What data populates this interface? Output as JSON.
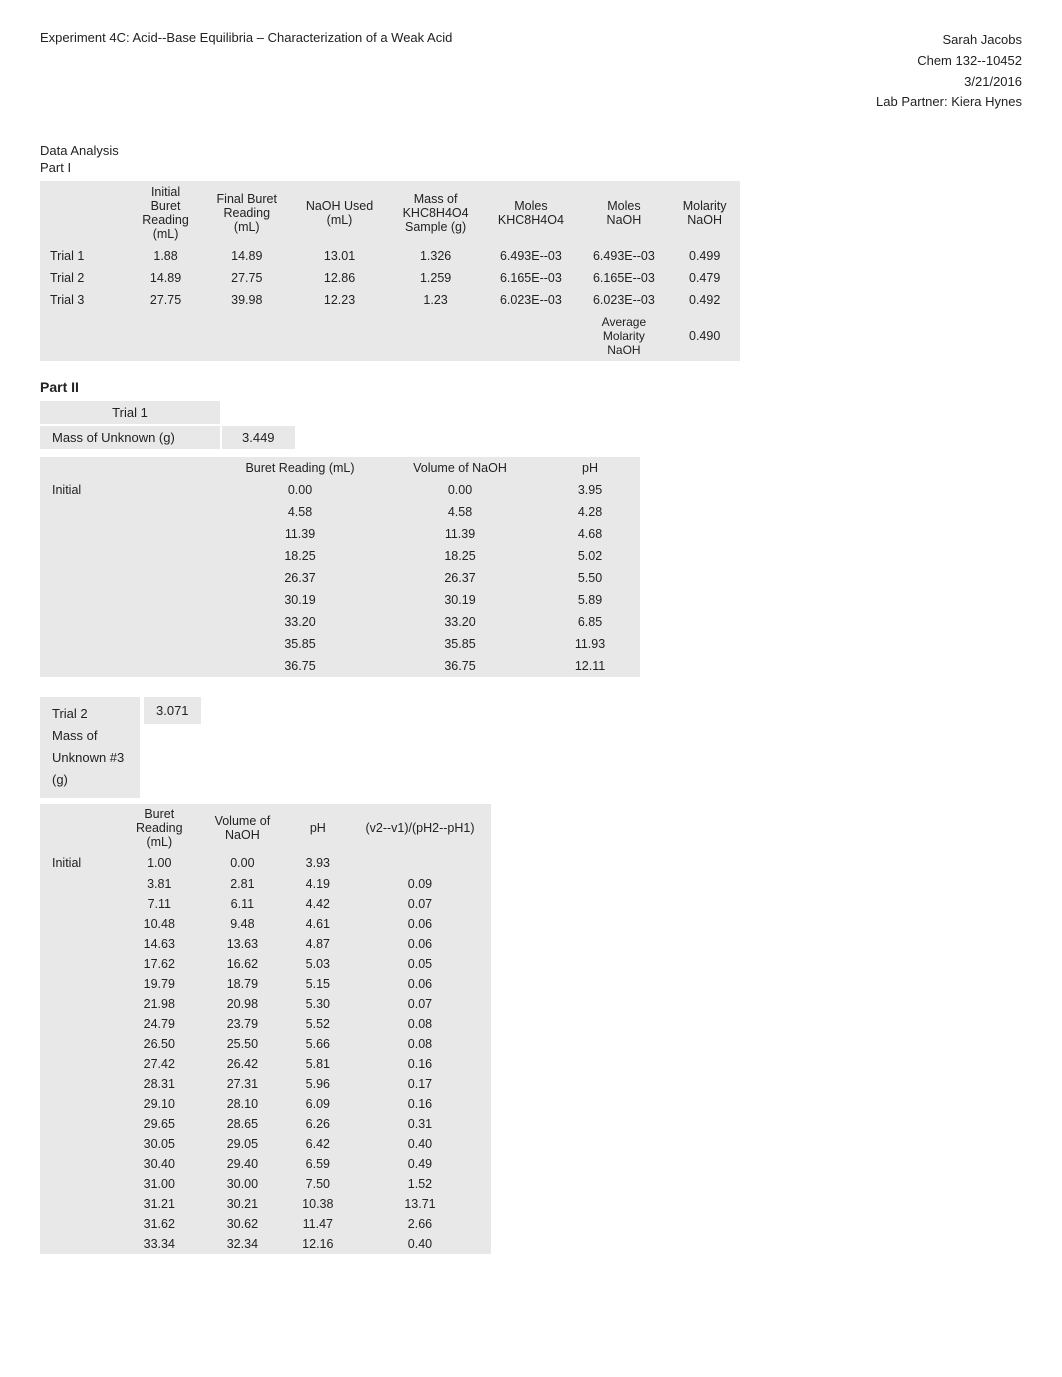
{
  "header": {
    "title": "Experiment 4C: Acid--Base Equilibria – Characterization of a Weak Acid",
    "name": "Sarah Jacobs",
    "course": "Chem 132--10452",
    "date": "3/21/2016",
    "partner": "Lab Partner: Kiera Hynes"
  },
  "dataAnalysis": "Data Analysis",
  "partI": {
    "label": "Part I",
    "columns": [
      "",
      "Initial Buret Reading (mL)",
      "Final Buret Reading (mL)",
      "NaOH Used (mL)",
      "Mass of KHC8H4O4 Sample (g)",
      "Moles KHC8H4O4",
      "Moles NaOH",
      "Molarity NaOH"
    ],
    "rows": [
      {
        "label": "Trial 1",
        "initial": "1.88",
        "final": "14.89",
        "used": "13.01",
        "mass": "1.326",
        "moles_khc": "6.493E--03",
        "moles_naoh": "6.493E--03",
        "molarity": "0.499"
      },
      {
        "label": "Trial 2",
        "initial": "14.89",
        "final": "27.75",
        "used": "12.86",
        "mass": "1.259",
        "moles_khc": "6.165E--03",
        "moles_naoh": "6.165E--03",
        "molarity": "0.479"
      },
      {
        "label": "Trial 3",
        "initial": "27.75",
        "final": "39.98",
        "used": "12.23",
        "mass": "1.23",
        "moles_khc": "6.023E--03",
        "moles_naoh": "6.023E--03",
        "molarity": "0.492"
      }
    ],
    "average_label": "Average Molarity NaOH",
    "average_value": "0.490"
  },
  "partII": {
    "label": "Part II",
    "trial1": {
      "label": "Trial 1",
      "mass_label": "Mass of Unknown (g)",
      "mass_value": "3.449",
      "col_buret": "Buret Reading (mL)",
      "col_volume": "Volume of NaOH",
      "col_ph": "pH",
      "initial_label": "Initial",
      "data_rows": [
        {
          "buret": "0.00",
          "volume": "0.00",
          "ph": "3.95"
        },
        {
          "buret": "4.58",
          "volume": "4.58",
          "ph": "4.28"
        },
        {
          "buret": "11.39",
          "volume": "11.39",
          "ph": "4.68"
        },
        {
          "buret": "18.25",
          "volume": "18.25",
          "ph": "5.02"
        },
        {
          "buret": "26.37",
          "volume": "26.37",
          "ph": "5.50"
        },
        {
          "buret": "30.19",
          "volume": "30.19",
          "ph": "5.89"
        },
        {
          "buret": "33.20",
          "volume": "33.20",
          "ph": "6.85"
        },
        {
          "buret": "35.85",
          "volume": "35.85",
          "ph": "11.93"
        },
        {
          "buret": "36.75",
          "volume": "36.75",
          "ph": "12.11"
        }
      ]
    },
    "trial2": {
      "label": "Trial 2",
      "mass_label1": "Mass of",
      "mass_label2": "Unknown #3",
      "mass_label3": "(g)",
      "mass_value": "3.071",
      "col_buret": "Buret Reading (mL)",
      "col_volume": "Volume of NaOH",
      "col_ph": "pH",
      "col_formula": "(v2--v1)/(pH2--pH1)",
      "initial_label": "Initial",
      "data_rows": [
        {
          "buret": "1.00",
          "volume": "0.00",
          "ph": "3.93",
          "formula": ""
        },
        {
          "buret": "3.81",
          "volume": "2.81",
          "ph": "4.19",
          "formula": "0.09"
        },
        {
          "buret": "7.11",
          "volume": "6.11",
          "ph": "4.42",
          "formula": "0.07"
        },
        {
          "buret": "10.48",
          "volume": "9.48",
          "ph": "4.61",
          "formula": "0.06"
        },
        {
          "buret": "14.63",
          "volume": "13.63",
          "ph": "4.87",
          "formula": "0.06"
        },
        {
          "buret": "17.62",
          "volume": "16.62",
          "ph": "5.03",
          "formula": "0.05"
        },
        {
          "buret": "19.79",
          "volume": "18.79",
          "ph": "5.15",
          "formula": "0.06"
        },
        {
          "buret": "21.98",
          "volume": "20.98",
          "ph": "5.30",
          "formula": "0.07"
        },
        {
          "buret": "24.79",
          "volume": "23.79",
          "ph": "5.52",
          "formula": "0.08"
        },
        {
          "buret": "26.50",
          "volume": "25.50",
          "ph": "5.66",
          "formula": "0.08"
        },
        {
          "buret": "27.42",
          "volume": "26.42",
          "ph": "5.81",
          "formula": "0.16"
        },
        {
          "buret": "28.31",
          "volume": "27.31",
          "ph": "5.96",
          "formula": "0.17"
        },
        {
          "buret": "29.10",
          "volume": "28.10",
          "ph": "6.09",
          "formula": "0.16"
        },
        {
          "buret": "29.65",
          "volume": "28.65",
          "ph": "6.26",
          "formula": "0.31"
        },
        {
          "buret": "30.05",
          "volume": "29.05",
          "ph": "6.42",
          "formula": "0.40"
        },
        {
          "buret": "30.40",
          "volume": "29.40",
          "ph": "6.59",
          "formula": "0.49"
        },
        {
          "buret": "31.00",
          "volume": "30.00",
          "ph": "7.50",
          "formula": "1.52"
        },
        {
          "buret": "31.21",
          "volume": "30.21",
          "ph": "10.38",
          "formula": "13.71"
        },
        {
          "buret": "31.62",
          "volume": "30.62",
          "ph": "11.47",
          "formula": "2.66"
        },
        {
          "buret": "33.34",
          "volume": "32.34",
          "ph": "12.16",
          "formula": "0.40"
        }
      ]
    }
  }
}
